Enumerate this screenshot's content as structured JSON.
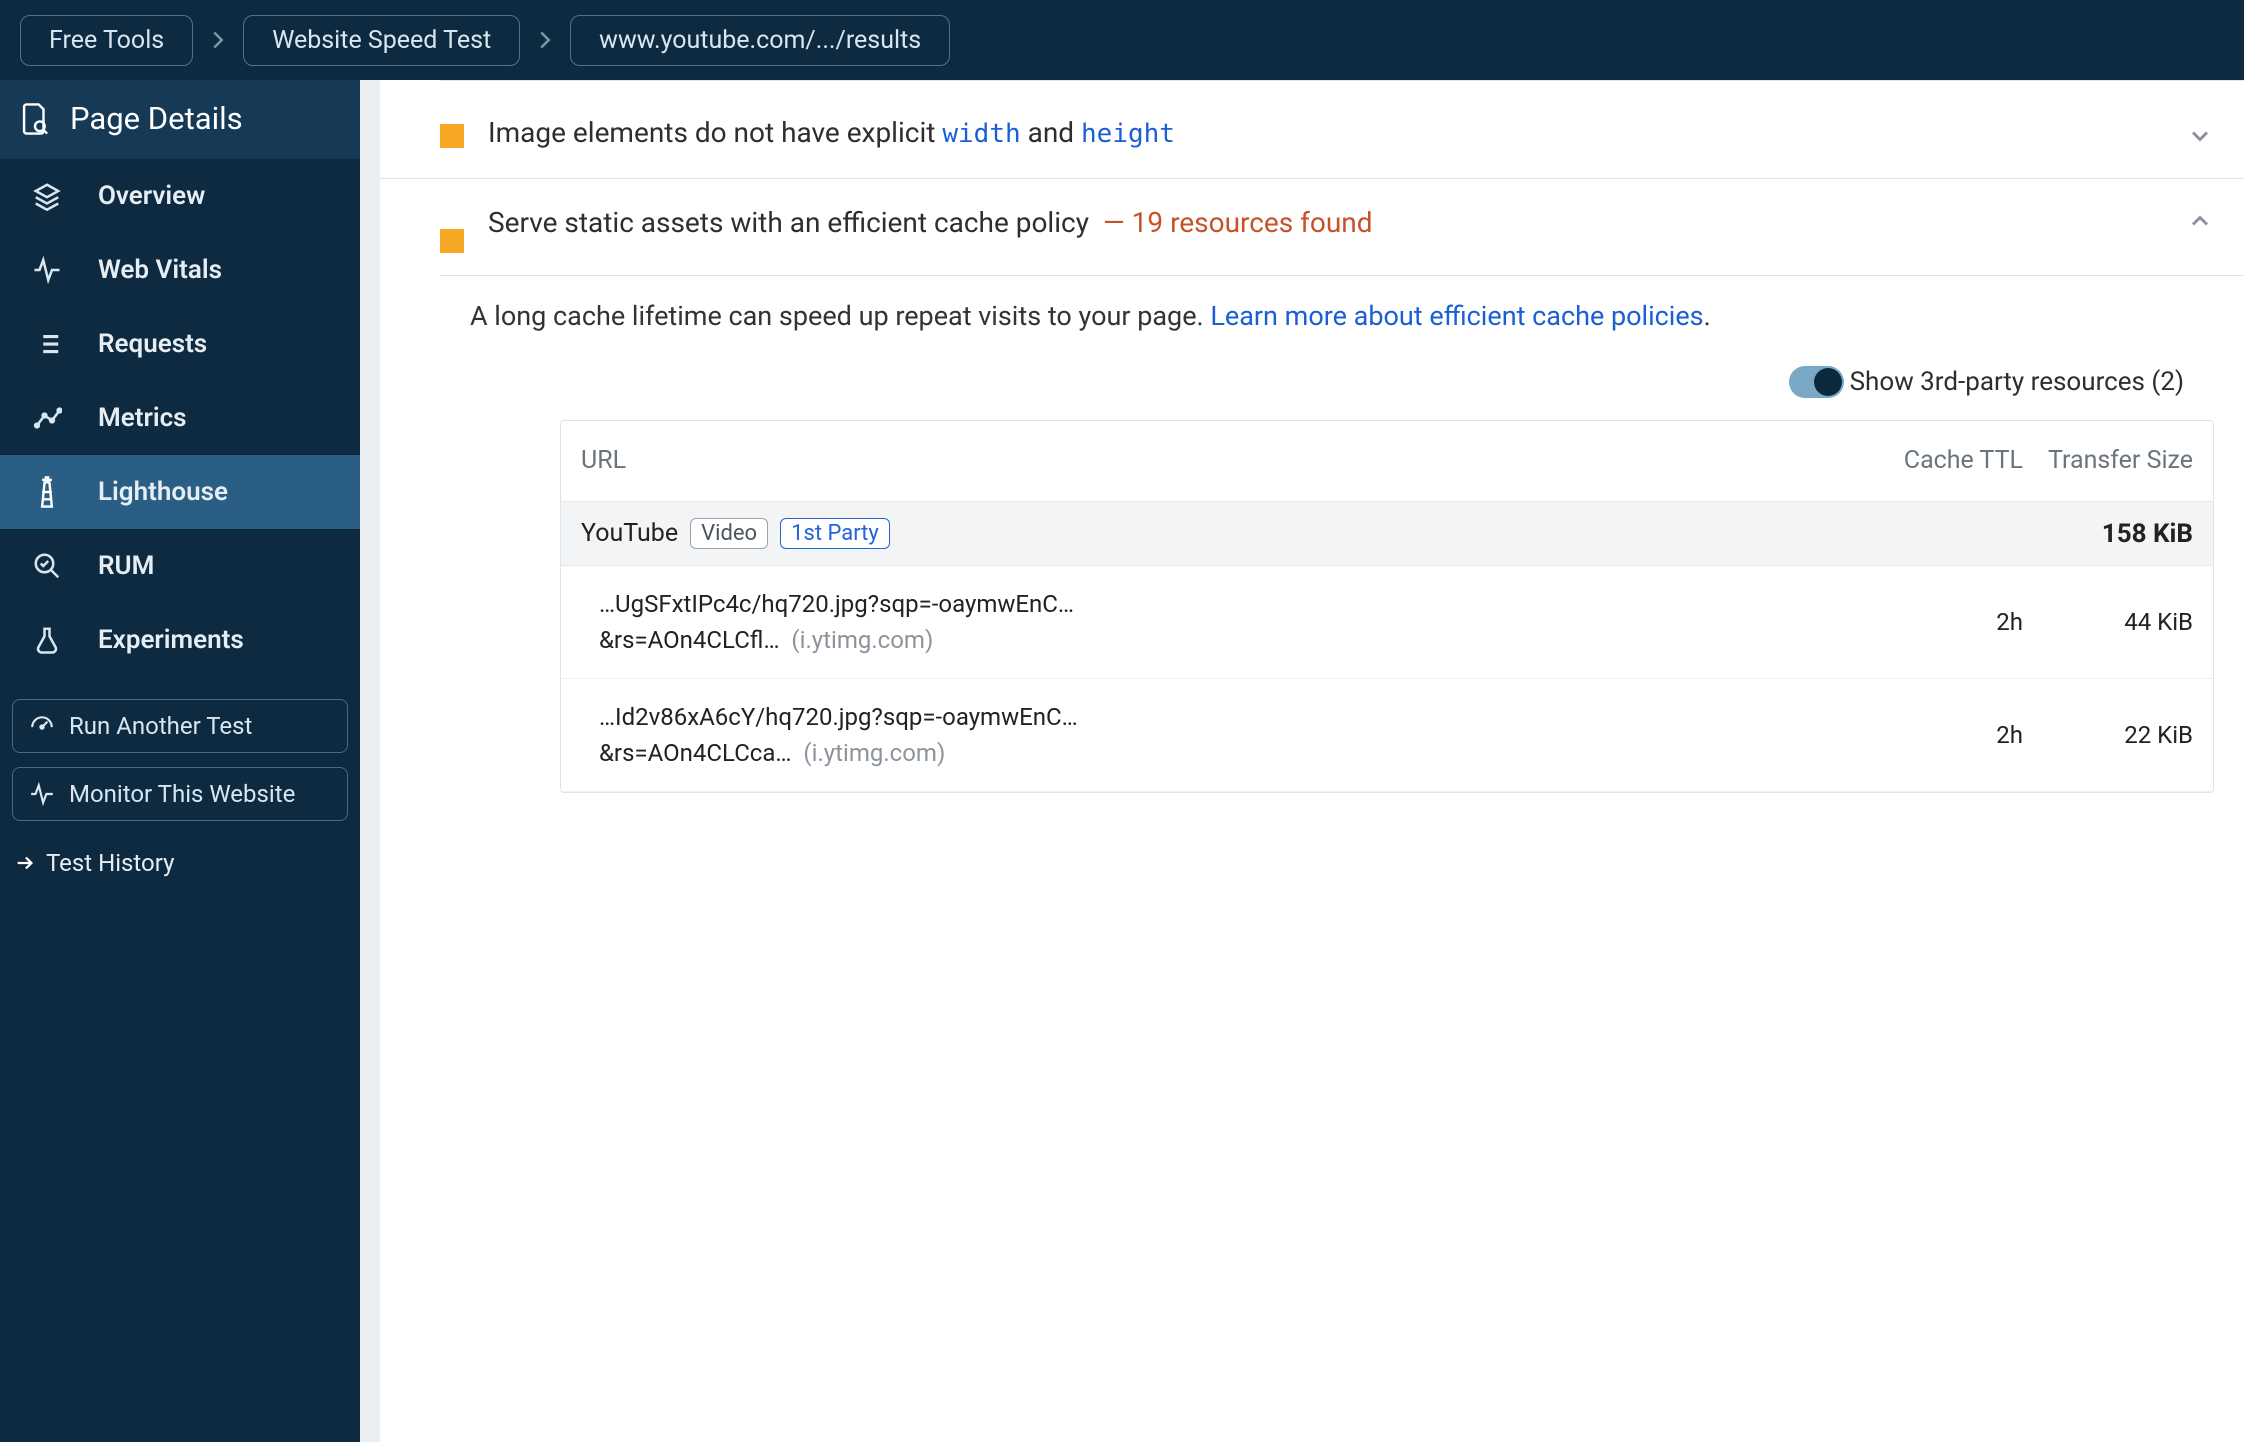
{
  "breadcrumb": {
    "items": [
      "Free Tools",
      "Website Speed Test",
      "www.youtube.com/.../results"
    ]
  },
  "sidebar": {
    "title": "Page Details",
    "items": [
      {
        "label": "Overview",
        "icon": "layers-icon"
      },
      {
        "label": "Web Vitals",
        "icon": "activity-icon"
      },
      {
        "label": "Requests",
        "icon": "list-icon"
      },
      {
        "label": "Metrics",
        "icon": "chart-icon"
      },
      {
        "label": "Lighthouse",
        "icon": "lighthouse-icon",
        "active": true
      },
      {
        "label": "RUM",
        "icon": "zoom-icon"
      },
      {
        "label": "Experiments",
        "icon": "flask-icon"
      }
    ],
    "actions": {
      "run_another": "Run Another Test",
      "monitor": "Monitor This Website"
    },
    "history_label": "Test History"
  },
  "audits": {
    "imageDims": {
      "prefix": "Image elements do not have explicit ",
      "code1": "width",
      "mid": " and ",
      "code2": "height"
    },
    "cache": {
      "title": "Serve static assets with an efficient cache policy",
      "meta": "— 19 resources found",
      "desc_part1": "A long cache lifetime can speed up repeat visits to your page. ",
      "desc_link": "Learn more about efficient cache policies",
      "desc_part2": "."
    }
  },
  "toggle": {
    "label": "Show 3rd-party resources (2)"
  },
  "table": {
    "headers": {
      "url": "URL",
      "ttl": "Cache TTL",
      "size": "Transfer Size"
    },
    "group": {
      "name": "YouTube",
      "chip1": "Video",
      "chip2": "1st Party",
      "size": "158 KiB"
    },
    "rows": [
      {
        "url_line1": "…UgSFxtIPc4c/hq720.jpg?sqp=-oaymwEnC…",
        "url_line2_prefix": "&rs=AOn4CLCfl…",
        "host": "(i.ytimg.com)",
        "ttl": "2h",
        "size": "44 KiB"
      },
      {
        "url_line1": "…Id2v86xA6cY/hq720.jpg?sqp=-oaymwEnC…",
        "url_line2_prefix": "&rs=AOn4CLCca…",
        "host": "(i.ytimg.com)",
        "ttl": "2h",
        "size": "22 KiB"
      }
    ]
  }
}
